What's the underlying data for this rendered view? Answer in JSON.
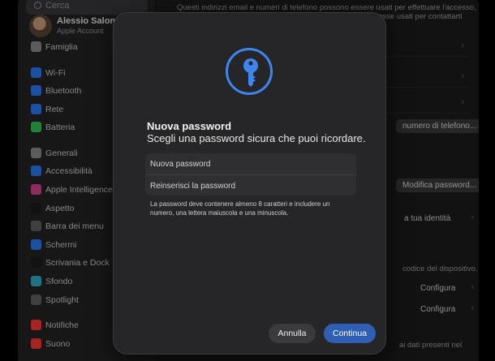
{
  "sidebar": {
    "search_placeholder": "Cerca",
    "account_name": "Alessio Salome",
    "account_sub": "Apple Account",
    "family": "Famiglia",
    "items": [
      {
        "label": "Wi-Fi",
        "color": "#2f7cf6"
      },
      {
        "label": "Bluetooth",
        "color": "#2f7cf6"
      },
      {
        "label": "Rete",
        "color": "#2f7cf6"
      },
      {
        "label": "Batteria",
        "color": "#34c759"
      },
      {
        "label": "Generali",
        "color": "#8e8e93"
      },
      {
        "label": "Accessibilità",
        "color": "#2f7cf6"
      },
      {
        "label": "Apple Intelligence e Siri",
        "color": "#d9468f"
      },
      {
        "label": "Aspetto",
        "color": "#1c1c1e"
      },
      {
        "label": "Barra dei menu",
        "color": "#636366"
      },
      {
        "label": "Schermi",
        "color": "#2f7cf6"
      },
      {
        "label": "Scrivania e Dock",
        "color": "#1c1c1e"
      },
      {
        "label": "Sfondo",
        "color": "#30b0c7"
      },
      {
        "label": "Spotlight",
        "color": "#636366"
      },
      {
        "label": "Notifiche",
        "color": "#ff3b30"
      },
      {
        "label": "Suono",
        "color": "#ff3b30"
      }
    ]
  },
  "content": {
    "intro_line1": "Questi indirizzi email e numeri di telefono possono essere usati per effettuare l'accesso,",
    "intro_line2": "esse usati per contattarti",
    "phone_button": "numero di telefono...",
    "edit_password_button": "Modifica password...",
    "identity_text": "a tua identità",
    "device_code_text": "codice del dispositivo.",
    "configure_1": "Configura",
    "configure_2": "Configura",
    "bottom_text": "ai dati presenti nel"
  },
  "modal": {
    "title": "Nuova password",
    "subtitle": "Scegli una password sicura che puoi ricordare.",
    "new_password_placeholder": "Nuova password",
    "confirm_password_placeholder": "Reinserisci la password",
    "hint": "La password deve contenere almeno 8 caratteri e includere un numero, una lettera maiuscola e una minuscola.",
    "cancel_label": "Annulla",
    "continue_label": "Continua",
    "icon": "key-icon",
    "accent_color": "#3d86f0"
  }
}
